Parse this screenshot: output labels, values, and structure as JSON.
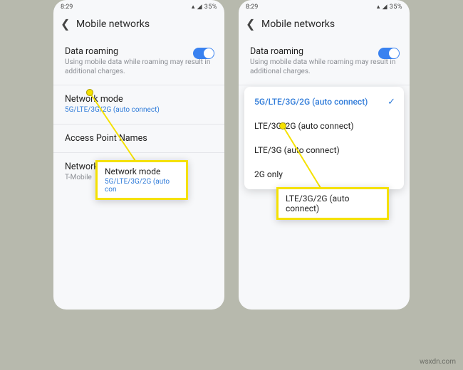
{
  "status": {
    "time": "8:29",
    "battery": "35%",
    "signal": "▴ ◢"
  },
  "appbar": {
    "title": "Mobile networks"
  },
  "left": {
    "roaming": {
      "title": "Data roaming",
      "desc": "Using mobile data while roaming may result in additional charges."
    },
    "netmode": {
      "title": "Network mode",
      "value": "5G/LTE/3G/2G (auto connect)"
    },
    "apn": {
      "title": "Access Point Names"
    },
    "ops": {
      "title": "Network operators",
      "value": "T-Mobile"
    }
  },
  "right": {
    "roaming": {
      "title": "Data roaming",
      "desc": "Using mobile data while roaming may result in additional charges."
    },
    "options": [
      "5G/LTE/3G/2G (auto connect)",
      "LTE/3G/2G (auto connect)",
      "LTE/3G (auto connect)",
      "2G only"
    ]
  },
  "callouts": {
    "c1_title": "Network mode",
    "c1_sub": "5G/LTE/3G/2G (auto con",
    "c2_title": "LTE/3G/2G (auto connect)"
  },
  "watermark": "wsxdn.com"
}
